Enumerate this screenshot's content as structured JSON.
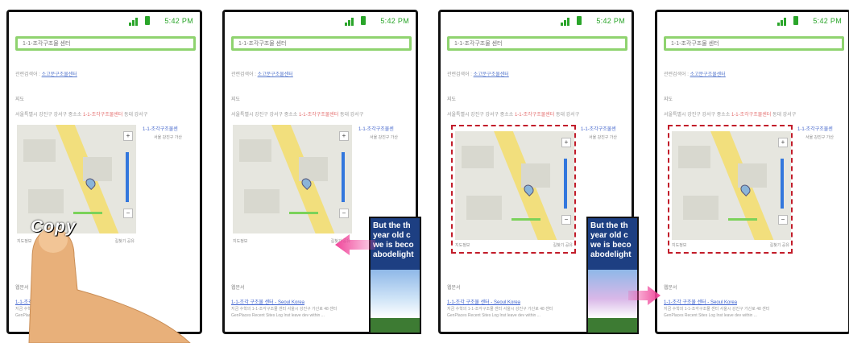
{
  "phones": [
    {
      "status_time": "5:42 PM",
      "search_query": "1-1-조각구조물 센터",
      "related_label": "관련검색어 :",
      "related_link": "소고문구조물센터",
      "section1": "지도",
      "description_prefix": "서울특별시 강진구 강서구 중소소",
      "description_red": "1-1-조각구조물센터",
      "description_suffix": "동대 강서구",
      "pin_link": "1-1-조각구조물센",
      "pin_address": "서울 강진구 가산",
      "map_footer_left": "지도정보",
      "map_footer_right": "길찾기  공유",
      "section2": "웹문서",
      "result_link": "1-1-조각 구조물 센터 - Seoul Korea",
      "result_text1": "지금 수학의 1-1-조각구조물 센터 서울시 강진구 가산로 48 센터",
      "result_text2": "GenPlaces Recent Sites Log Inst leave dev within ..."
    },
    {
      "status_time": "5:42 PM",
      "search_query": "1-1-조각구조물 센터",
      "related_label": "관련검색어 :",
      "related_link": "소고문구조물센터",
      "section1": "지도",
      "description_prefix": "서울특별시 강진구 강서구 중소소",
      "description_red": "1-1-조각구조물센터",
      "description_suffix": "동대 강서구",
      "pin_link": "1-1-조각구조물센",
      "pin_address": "서울 강진구 가산",
      "map_footer_left": "지도정보",
      "map_footer_right": "길찾기  공유",
      "section2": "웹문서",
      "result_link": "1-1-조각 구조물 센터 - Seoul Korea",
      "result_text1": "지금 수학의 1-1-조각구조물 센터 서울시 강진구 가산로 48 센터",
      "result_text2": "GenPlaces Recent Sites Log Inst leave dev within ..."
    },
    {
      "status_time": "5:42 PM",
      "search_query": "1-1-조각구조물 센터",
      "related_label": "관련검색어 :",
      "related_link": "소고문구조물센터",
      "section1": "지도",
      "description_prefix": "서울특별시 강진구 강서구 중소소",
      "description_red": "1-1-조각구조물센터",
      "description_suffix": "동대 강서구",
      "pin_link": "1-1-조각구조물센",
      "pin_address": "서울 강진구 가산",
      "map_footer_left": "지도정보",
      "map_footer_right": "길찾기  공유",
      "section2": "웹문서",
      "result_link": "1-1-조각 구조물 센터 - Seoul Korea",
      "result_text1": "지금 수학의 1-1-조각구조물 센터 서울시 강진구 가산로 48 센터",
      "result_text2": "GenPlaces Recent Sites Log Inst leave dev within ..."
    },
    {
      "status_time": "5:42 PM",
      "search_query": "1-1-조각구조물 센터",
      "related_label": "관련검색어 :",
      "related_link": "소고문구조물센터",
      "section1": "지도",
      "description_prefix": "서울특별시 강진구 강서구 중소소",
      "description_red": "1-1-조각구조물센터",
      "description_suffix": "동대 강서구",
      "pin_link": "1-1-조각구조물센",
      "pin_address": "서울 강진구 가산",
      "map_footer_left": "지도정보",
      "map_footer_right": "길찾기  공유",
      "section2": "웹문서",
      "result_link": "1-1-조각 구조물 센터 - Seoul Korea",
      "result_text1": "지금 수학의 1-1-조각구조물 센터 서울시 강진구 가산로 48 센터",
      "result_text2": "GenPlaces Recent Sites Log Inst leave dev within ..."
    }
  ],
  "copy_gesture_label": "Copy",
  "clipboard_overlay_text": "But the th year old c we is beco abodelight",
  "colors": {
    "search_border": "#8fd36f",
    "selection_dash": "#c21c2a",
    "arrow": "#f0449a",
    "overlay_text_bg": "#1d3f82"
  }
}
